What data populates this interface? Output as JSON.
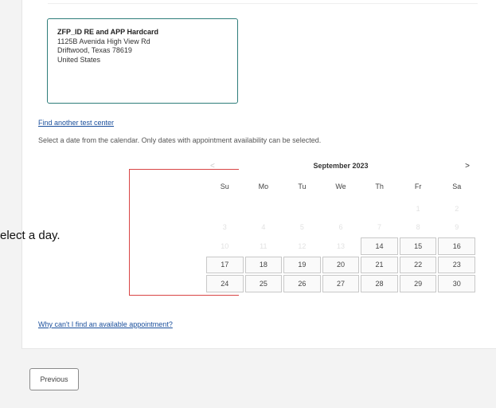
{
  "test_center": {
    "name": "ZFP_ID RE and APP Hardcard",
    "street": "1125B Avenida High View Rd",
    "city_line": "Driftwood, Texas 78619",
    "country": "United States"
  },
  "links": {
    "find_another": "Find another test center",
    "why_cant": "Why can't I find an available appointment?"
  },
  "instruction": "Select a date from the calendar. Only dates with appointment availability can be selected.",
  "side_annotation": "elect a day.",
  "calendar": {
    "prev_label": "<",
    "next_label": ">",
    "month_title": "September 2023",
    "weekdays": [
      "Su",
      "Mo",
      "Tu",
      "We",
      "Th",
      "Fr",
      "Sa"
    ],
    "cells": [
      {
        "label": "",
        "state": "empty"
      },
      {
        "label": "",
        "state": "empty"
      },
      {
        "label": "",
        "state": "empty"
      },
      {
        "label": "",
        "state": "empty"
      },
      {
        "label": "",
        "state": "empty"
      },
      {
        "label": "1",
        "state": "disabled"
      },
      {
        "label": "2",
        "state": "disabled"
      },
      {
        "label": "3",
        "state": "disabled"
      },
      {
        "label": "4",
        "state": "disabled"
      },
      {
        "label": "5",
        "state": "disabled"
      },
      {
        "label": "6",
        "state": "disabled"
      },
      {
        "label": "7",
        "state": "disabled"
      },
      {
        "label": "8",
        "state": "disabled"
      },
      {
        "label": "9",
        "state": "disabled"
      },
      {
        "label": "10",
        "state": "disabled"
      },
      {
        "label": "11",
        "state": "disabled"
      },
      {
        "label": "12",
        "state": "disabled"
      },
      {
        "label": "13",
        "state": "disabled"
      },
      {
        "label": "14",
        "state": "available"
      },
      {
        "label": "15",
        "state": "available"
      },
      {
        "label": "16",
        "state": "available"
      },
      {
        "label": "17",
        "state": "available"
      },
      {
        "label": "18",
        "state": "available"
      },
      {
        "label": "19",
        "state": "available"
      },
      {
        "label": "20",
        "state": "available"
      },
      {
        "label": "21",
        "state": "available"
      },
      {
        "label": "22",
        "state": "available"
      },
      {
        "label": "23",
        "state": "available"
      },
      {
        "label": "24",
        "state": "available"
      },
      {
        "label": "25",
        "state": "available"
      },
      {
        "label": "26",
        "state": "available"
      },
      {
        "label": "27",
        "state": "available"
      },
      {
        "label": "28",
        "state": "available"
      },
      {
        "label": "29",
        "state": "available"
      },
      {
        "label": "30",
        "state": "available"
      }
    ]
  },
  "footer": {
    "previous_label": "Previous"
  },
  "colors": {
    "highlight_outline": "#d94545",
    "card_border": "#2e7d7a",
    "link": "#1a4f9c"
  }
}
